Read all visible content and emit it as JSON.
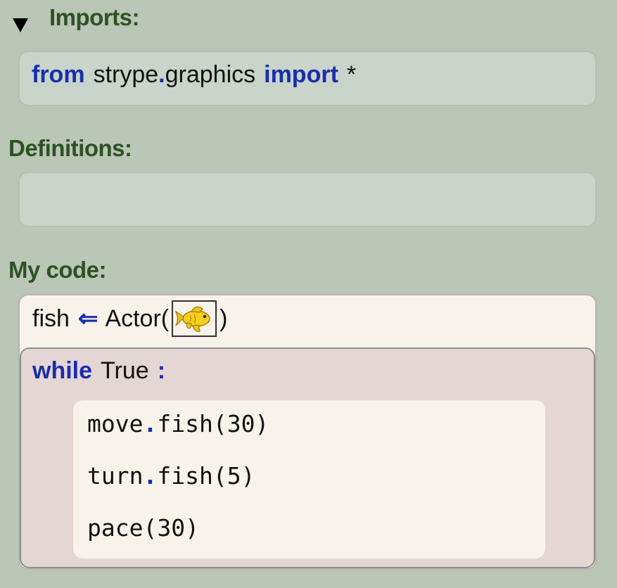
{
  "sections": {
    "imports": {
      "heading": "Imports:",
      "lines": [
        {
          "kw_from": "from",
          "module_part1": "strype",
          "dot": ".",
          "module_part2": "graphics",
          "kw_import": "import",
          "star": "*"
        }
      ]
    },
    "definitions": {
      "heading": "Definitions:"
    },
    "main": {
      "heading": "My code:",
      "assignment": {
        "var": "fish",
        "arrow": "⇐",
        "call": "Actor(",
        "close": ")",
        "image_icon": "goldfish-icon"
      },
      "while": {
        "kw_while": "while",
        "condition": "True",
        "colon": ":",
        "body": [
          {
            "obj": "move",
            "dot": ".",
            "method": "fish(30)"
          },
          {
            "obj": "turn",
            "dot": ".",
            "method": "fish(5)"
          },
          {
            "obj": "pace(30)",
            "dot": "",
            "method": ""
          }
        ]
      }
    }
  },
  "colors": {
    "background": "#bac6b6",
    "heading": "#2d5224",
    "keyword": "#1a2eab",
    "frame_fill": "#c9d4ca",
    "code_fill": "#f7f2ea",
    "while_fill": "#e4d6d5"
  }
}
